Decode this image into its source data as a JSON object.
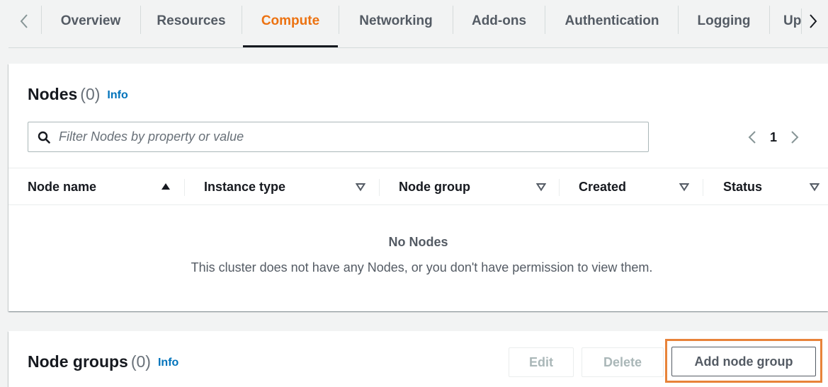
{
  "tabs": {
    "items": [
      {
        "label": "Overview"
      },
      {
        "label": "Resources"
      },
      {
        "label": "Compute"
      },
      {
        "label": "Networking"
      },
      {
        "label": "Add-ons"
      },
      {
        "label": "Authentication"
      },
      {
        "label": "Logging"
      },
      {
        "label": "Up"
      }
    ],
    "active": "Compute",
    "active_color": "#ec7211"
  },
  "nodes_panel": {
    "title": "Nodes",
    "count": "(0)",
    "info": "Info",
    "filter_placeholder": "Filter Nodes by property or value",
    "filter_value": "",
    "page": "1",
    "columns": [
      {
        "label": "Node name",
        "sort": "ascending"
      },
      {
        "label": "Instance type",
        "sort": "none"
      },
      {
        "label": "Node group",
        "sort": "none"
      },
      {
        "label": "Created",
        "sort": "none"
      },
      {
        "label": "Status",
        "sort": "none"
      }
    ],
    "empty_title": "No Nodes",
    "empty_desc": "This cluster does not have any Nodes, or you don't have permission to view them."
  },
  "node_groups_panel": {
    "title": "Node groups",
    "count": "(0)",
    "info": "Info",
    "edit_label": "Edit",
    "delete_label": "Delete",
    "add_label": "Add node group",
    "highlight_color": "#e8833a"
  }
}
